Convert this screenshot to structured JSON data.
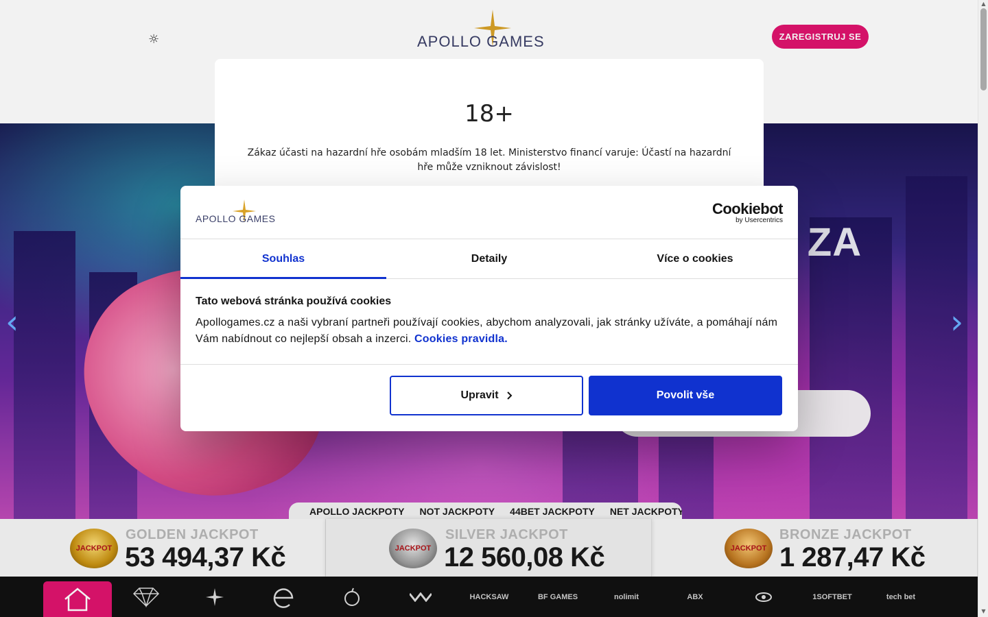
{
  "header": {
    "brand_name": "APOLLO GAMES",
    "register_label": "ZAREGISTRUJ SE",
    "theme_toggle_icon": "sun-icon"
  },
  "hero": {
    "headline_fragment": "S ZA"
  },
  "jackpot_tabs": [
    "APOLLO JACKPOTY",
    "NOT JACKPOTY",
    "44BET JACKPOTY",
    "NET JACKPOTY"
  ],
  "jackpots": [
    {
      "name": "GOLDEN JACKPOT",
      "amount": "53 494,37 Kč",
      "badge": "JACKPOT"
    },
    {
      "name": "SILVER JACKPOT",
      "amount": "12 560,08 Kč",
      "badge": "JACKPOT"
    },
    {
      "name": "BRONZE JACKPOT",
      "amount": "1 287,47 Kč",
      "badge": "JACKPOT"
    }
  ],
  "providers": [
    "home-icon",
    "diamond-icon",
    "star-icon",
    "e-logo-icon",
    "play-logo-icon",
    "w-logo-icon",
    "HACKSAW",
    "BF GAMES",
    "nolimit",
    "ABX",
    "eye-logo-icon",
    "1SOFTBET",
    "tech bet"
  ],
  "age_modal": {
    "title": "18+",
    "text": "Zákaz účasti na hazardní hře osobám mladším 18 let. Ministerstvo financí varuje: Účastí na hazardní hře může vzniknout závislost!"
  },
  "cookie_banner": {
    "logo_text": "APOLLO GAMES",
    "brand": "Cookiebot",
    "brand_sub": "by Usercentrics",
    "tabs": [
      "Souhlas",
      "Detaily",
      "Více o cookies"
    ],
    "active_tab": "Souhlas",
    "heading": "Tato webová stránka používá cookies",
    "body": "Apollogames.cz a naši vybraní partneři používají cookies, abychom analyzovali, jak stránky užíváte, a pomáhají nám Vám nabídnout co nejlepší obsah a inzerci.",
    "link": "Cookies pravidla.",
    "btn_customize": "Upravit",
    "btn_allow": "Povolit vše",
    "accent": "#1032cf"
  },
  "colors": {
    "brand_pink": "#e0136e",
    "cookie_blue": "#1032cf"
  }
}
